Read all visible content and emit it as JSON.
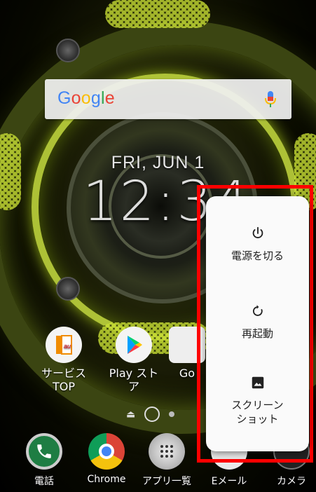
{
  "search": {
    "logo": "Google"
  },
  "lockscreen": {
    "date": "FRI, JUN 1",
    "time": "12:34"
  },
  "home_apps": [
    {
      "label_line1": "サービス",
      "label_line2": "TOP",
      "icon": "au-service-icon"
    },
    {
      "label_line1": "Play スト",
      "label_line2": "ア",
      "icon": "play-store-icon"
    },
    {
      "label_line1": "Go",
      "label_line2": "",
      "icon": "google-folder-icon"
    }
  ],
  "dock": [
    {
      "label": "電話",
      "icon": "phone-icon"
    },
    {
      "label": "Chrome",
      "icon": "chrome-icon"
    },
    {
      "label": "アプリ一覧",
      "icon": "app-drawer-icon"
    },
    {
      "label": "Eメール",
      "icon": "email-icon"
    },
    {
      "label": "カメラ",
      "icon": "camera-icon"
    }
  ],
  "power_menu": {
    "items": [
      {
        "label": "電源を切る",
        "icon": "power-icon"
      },
      {
        "label": "再起動",
        "icon": "restart-icon"
      },
      {
        "label_line1": "スクリーン",
        "label_line2": "ショット",
        "icon": "screenshot-icon"
      }
    ],
    "highlight_color": "#ff0000"
  },
  "colors": {
    "accent": "#c8de35",
    "menu_bg": "#fafafa"
  }
}
